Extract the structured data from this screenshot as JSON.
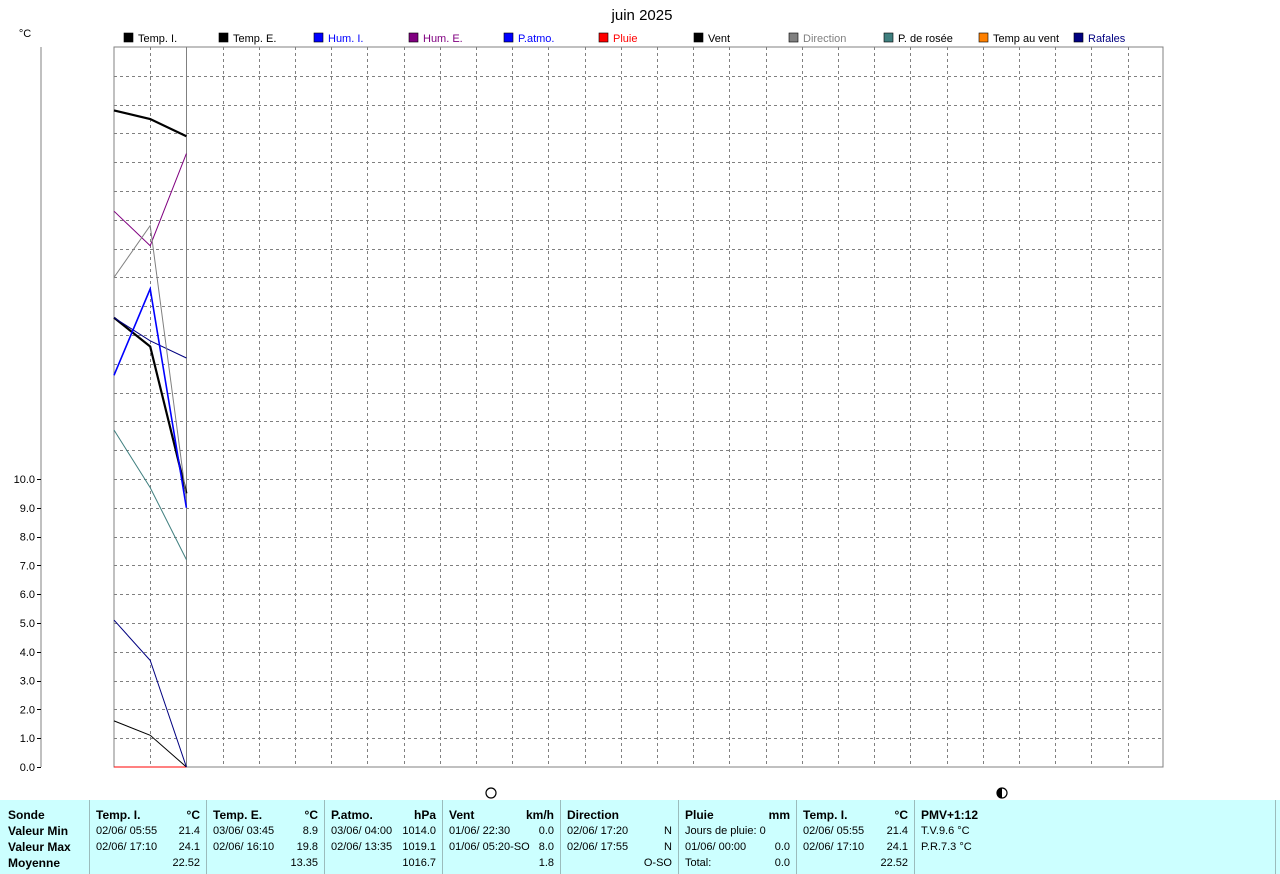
{
  "chart_data": {
    "type": "line",
    "title": "juin 2025",
    "ylabel": "°C",
    "ylim": [
      0,
      25
    ],
    "y_tick_labels": [
      "0.0",
      "1.0",
      "2.0",
      "3.0",
      "4.0",
      "5.0",
      "6.0",
      "7.0",
      "8.0",
      "9.0",
      "10.0"
    ],
    "x": [
      0,
      1,
      2
    ],
    "grid": true,
    "legend_position": "top",
    "moon_phases": [
      "new-moon",
      "last-quarter"
    ],
    "legend": [
      {
        "name": "Temp. I.",
        "color": "#000000"
      },
      {
        "name": "Temp. E.",
        "color": "#000000"
      },
      {
        "name": "Hum. I.",
        "color": "#0000ff"
      },
      {
        "name": "Hum. E.",
        "color": "#800080"
      },
      {
        "name": "P.atmo.",
        "color": "#0000ff"
      },
      {
        "name": "Pluie",
        "color": "#ff0000"
      },
      {
        "name": "Vent",
        "color": "#000000"
      },
      {
        "name": "Direction",
        "color": "#808080"
      },
      {
        "name": "P. de rosée",
        "color": "#3f7f7f"
      },
      {
        "name": "Temp au vent",
        "color": "#ff8000"
      },
      {
        "name": "Rafales",
        "color": "#000080"
      }
    ],
    "series": [
      {
        "name": "Temp. I.",
        "color": "#000000",
        "width": 2.2,
        "values": [
          22.8,
          22.5,
          21.9
        ]
      },
      {
        "name": "Temp. E.",
        "color": "#000000",
        "width": 2.2,
        "values": [
          15.6,
          14.6,
          9.5
        ]
      },
      {
        "name": "Hum. I.",
        "color": "#000080",
        "width": 1,
        "values": [
          15.6,
          14.8,
          14.2
        ]
      },
      {
        "name": "Hum. E.",
        "color": "#800080",
        "width": 1,
        "values": [
          19.3,
          18.1,
          21.3
        ]
      },
      {
        "name": "P.atmo.",
        "color": "#0000ff",
        "width": 1.6,
        "values": [
          13.6,
          16.6,
          9.0
        ]
      },
      {
        "name": "Pluie",
        "color": "#ff0000",
        "width": 1,
        "values": [
          0.0,
          0.0,
          0.0
        ]
      },
      {
        "name": "Vent",
        "color": "#000000",
        "width": 1,
        "values": [
          1.6,
          1.1,
          0.0
        ]
      },
      {
        "name": "Direction",
        "color": "#808080",
        "width": 1,
        "values": [
          17.0,
          18.8,
          9.3
        ]
      },
      {
        "name": "P. de rosée",
        "color": "#3f7f7f",
        "width": 1,
        "values": [
          11.7,
          9.7,
          7.2
        ]
      },
      {
        "name": "Rafales",
        "color": "#000080",
        "width": 1,
        "values": [
          5.1,
          3.7,
          0.0
        ]
      }
    ]
  },
  "summary": {
    "row_labels": {
      "header": "Sonde",
      "min": "Valeur Min",
      "max": "Valeur Max",
      "avg": "Moyenne"
    },
    "temp_i": {
      "label": "Temp. I.",
      "unit": "°C",
      "min_date": "02/06/  05:55",
      "min_val": "21.4",
      "max_date": "02/06/  17:10",
      "max_val": "24.1",
      "avg": "22.52"
    },
    "temp_e": {
      "label": "Temp. E.",
      "unit": "°C",
      "min_date": "03/06/  03:45",
      "min_val": "8.9",
      "max_date": "02/06/  16:10",
      "max_val": "19.8",
      "avg": "13.35"
    },
    "patmo": {
      "label": "P.atmo.",
      "unit": "hPa",
      "min_date": "03/06/  04:00",
      "min_val": "1014.0",
      "max_date": "02/06/  13:35",
      "max_val": "1019.1",
      "avg": "1016.7"
    },
    "vent": {
      "label": "Vent",
      "unit": "km/h",
      "min_date": "01/06/  22:30",
      "min_val": "0.0",
      "max_date": "01/06/  05:20-SO",
      "max_val": "8.0",
      "avg": "1.8"
    },
    "direction": {
      "label": "Direction",
      "min_date": "02/06/  17:20",
      "min_val": "N",
      "max_date": "02/06/  17:55",
      "max_val": "N",
      "avg": "O-SO"
    },
    "pluie": {
      "label": "Pluie",
      "unit": "mm",
      "min_text": "Jours de pluie: 0",
      "max_date": "01/06/  00:00",
      "max_val": "0.0",
      "total_label": "Total:",
      "total_val": "0.0"
    },
    "temp_i2": {
      "label": "Temp. I.",
      "unit": "°C",
      "min_date": "02/06/  05:55",
      "min_val": "21.4",
      "max_date": "02/06/  17:10",
      "max_val": "24.1",
      "avg": "22.52"
    },
    "pmv": {
      "label": "PMV+1:12",
      "tv": "T.V.9.6 °C",
      "pr": "P.R.7.3 °C"
    }
  }
}
